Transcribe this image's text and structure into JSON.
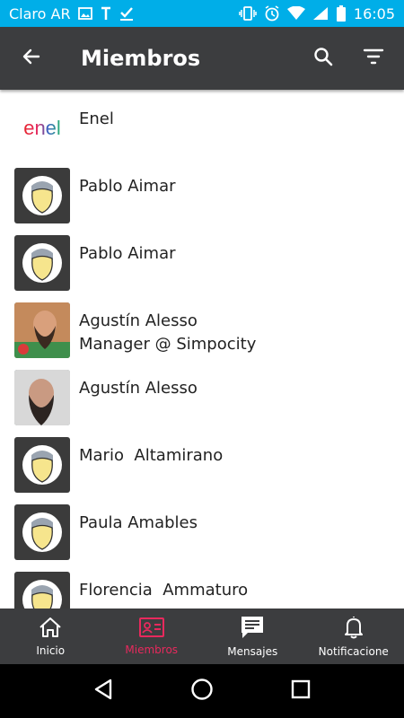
{
  "status_bar": {
    "carrier": "Claro AR",
    "time": "16:05",
    "icons_left": [
      "image-icon",
      "text-icon",
      "check-icon"
    ],
    "icons_right": [
      "vibrate-icon",
      "alarm-icon",
      "wifi-icon",
      "signal-icon",
      "battery-icon"
    ]
  },
  "app_bar": {
    "title": "Miembros",
    "back_icon": "arrow-back-icon",
    "search_icon": "search-icon",
    "filter_icon": "filter-icon"
  },
  "members": [
    {
      "name": "Enel",
      "subtitle": "",
      "avatar": "logo"
    },
    {
      "name": "Pablo Aimar",
      "subtitle": "",
      "avatar": "default"
    },
    {
      "name": "Pablo Aimar",
      "subtitle": "",
      "avatar": "default"
    },
    {
      "name": "Agustín Alesso",
      "subtitle": "Manager @ Simpocity",
      "avatar": "photo"
    },
    {
      "name": "Agustín Alesso",
      "subtitle": "",
      "avatar": "photo"
    },
    {
      "name": "Mario  Altamirano",
      "subtitle": "",
      "avatar": "default"
    },
    {
      "name": "Paula Amables",
      "subtitle": "",
      "avatar": "default"
    },
    {
      "name": "Florencia  Ammaturo",
      "subtitle": "",
      "avatar": "default"
    }
  ],
  "logo_text": "enel",
  "bottom_nav": {
    "items": [
      {
        "label": "Inicio",
        "icon": "home-icon",
        "active": false
      },
      {
        "label": "Miembros",
        "icon": "members-card-icon",
        "active": true
      },
      {
        "label": "Mensajes",
        "icon": "messages-icon",
        "active": false
      },
      {
        "label": "Notificacione",
        "icon": "bell-icon",
        "active": false
      }
    ]
  },
  "colors": {
    "status_bar": "#00aee8",
    "app_bar": "#3c3d3f",
    "accent": "#e8295d"
  }
}
